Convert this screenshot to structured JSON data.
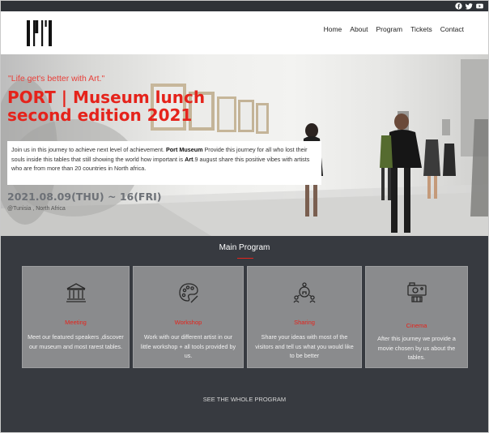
{
  "social": {
    "icons": [
      "facebook-icon",
      "twitter-icon",
      "youtube-icon"
    ]
  },
  "header": {
    "logo": "museum-logo",
    "nav": [
      "Home",
      "About",
      "Program",
      "Tickets",
      "Contact"
    ]
  },
  "hero": {
    "quote": "\"Life get's better with Art.\"",
    "title_line1": "PORT | Museum lunch",
    "title_line2": "second edition 2021",
    "intro_1": "Join us in this journey to achieve next level of achievement. ",
    "intro_brand": "Port Museum",
    "intro_2": " Provide this journey for all who lost their souls inside this tables that still showing the world how important is ",
    "intro_art": "Art",
    "intro_3": ".9 august share this positive vibes with artists who are from more than 20 countries in North africa.",
    "date": "2021.08.09(THU) ~ 16(FRI)",
    "location": "@Tunisia , North Africa"
  },
  "program": {
    "title": "Main Program",
    "cards": [
      {
        "icon": "museum-icon",
        "title": "Meeting",
        "text": "Meet our featured speakers ,discover our museum and most rarest tables."
      },
      {
        "icon": "palette-icon",
        "title": "Workshop",
        "text": "Work with our different artist in our little workshop + all tools provided by us."
      },
      {
        "icon": "idea-sharing-icon",
        "title": "Sharing",
        "text": "Share your ideas with most of the visitors and tell us what you would like to be better"
      },
      {
        "icon": "film-camera-icon",
        "title": "Cinema",
        "text": "After this journey we provide a movie chosen by us about the tables."
      }
    ],
    "see_all": "SEE THE WHOLE PROGRAM"
  },
  "colors": {
    "accent": "#e5231b",
    "topbar": "#2f3237",
    "section_bg": "#373a40",
    "card_bg": "#8a8b8d"
  }
}
